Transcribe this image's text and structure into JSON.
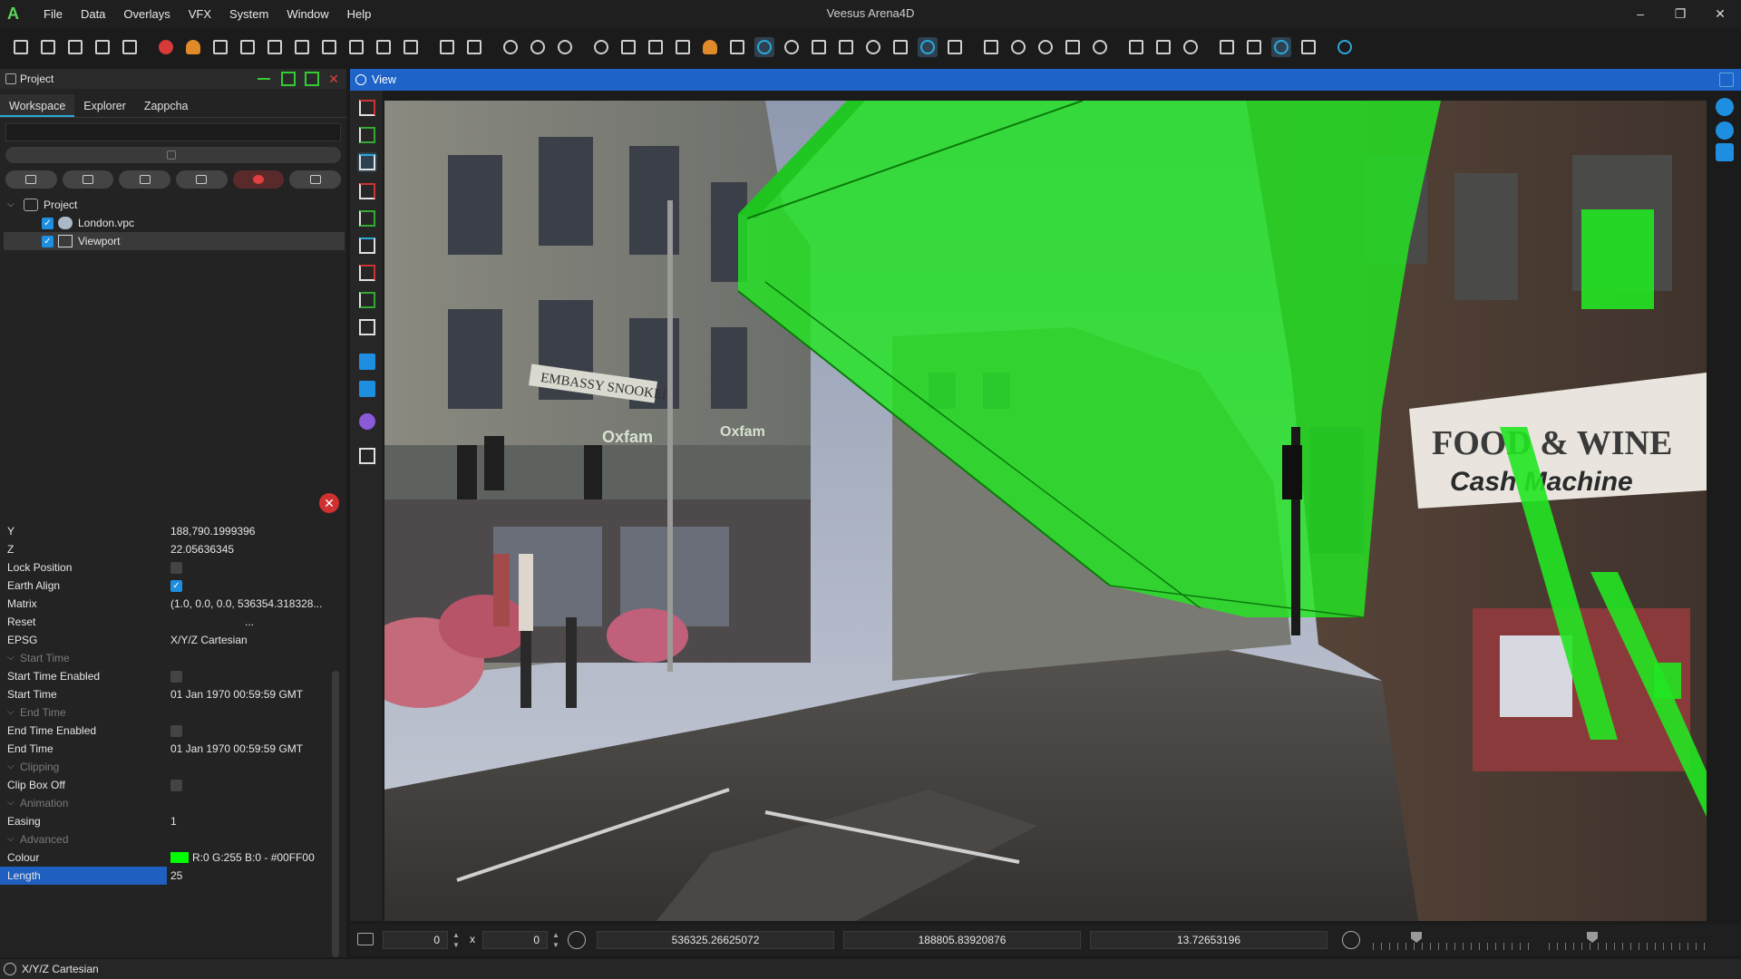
{
  "app": {
    "title": "Veesus Arena4D",
    "logo": "A",
    "menu": [
      "File",
      "Data",
      "Overlays",
      "VFX",
      "System",
      "Window",
      "Help"
    ],
    "window_controls": [
      "–",
      "❐",
      "✕"
    ]
  },
  "project_panel": {
    "title": "Project",
    "tabs": [
      "Workspace",
      "Explorer",
      "Zappcha"
    ],
    "active_tab": "Workspace",
    "tree": {
      "root": "Project",
      "items": [
        {
          "label": "London.vpc",
          "checked": true,
          "icon": "cloud-icon"
        },
        {
          "label": "Viewport",
          "checked": true,
          "icon": "viewport-icon"
        }
      ]
    }
  },
  "properties": {
    "rows": [
      {
        "type": "value",
        "key": "Y",
        "value": "188,790.1999396"
      },
      {
        "type": "value",
        "key": "Z",
        "value": "22.05636345"
      },
      {
        "type": "check",
        "key": "Lock Position",
        "checked": false
      },
      {
        "type": "check",
        "key": "Earth Align",
        "checked": true
      },
      {
        "type": "value",
        "key": "Matrix",
        "value": "(1.0, 0.0, 0.0, 536354.318328..."
      },
      {
        "type": "value",
        "key": "Reset",
        "value": "..."
      },
      {
        "type": "value",
        "key": "EPSG",
        "value": "X/Y/Z Cartesian"
      },
      {
        "type": "section",
        "key": "Start Time"
      },
      {
        "type": "check",
        "key": "Start Time Enabled",
        "checked": false
      },
      {
        "type": "value",
        "key": "Start Time",
        "value": "01 Jan 1970 00:59:59 GMT"
      },
      {
        "type": "section",
        "key": "End Time"
      },
      {
        "type": "check",
        "key": "End Time Enabled",
        "checked": false
      },
      {
        "type": "value",
        "key": "End Time",
        "value": "01 Jan 1970 00:59:59 GMT"
      },
      {
        "type": "section",
        "key": "Clipping"
      },
      {
        "type": "check",
        "key": "Clip Box Off",
        "checked": false
      },
      {
        "type": "section",
        "key": "Animation"
      },
      {
        "type": "value",
        "key": "Easing",
        "value": "1"
      },
      {
        "type": "section",
        "key": "Advanced"
      },
      {
        "type": "colour",
        "key": "Colour",
        "value": "R:0 G:255 B:0 - #00FF00",
        "color": "#00ff00"
      },
      {
        "type": "value",
        "key": "Length",
        "value": "25",
        "selected": true
      }
    ]
  },
  "view": {
    "title": "View",
    "width_value": "0",
    "x_label": "x",
    "height_value": "0",
    "coord_x": "536325.26625072",
    "coord_y": "188805.83920876",
    "coord_z": "13.72653196",
    "scene_sign_1": "FOOD & WINE",
    "scene_sign_2": "Cash Machine",
    "scene_sign_3": "EMBASSY SNOOKER",
    "scene_sign_4": "Oxfam"
  },
  "status": {
    "text": "X/Y/Z Cartesian"
  },
  "colors": {
    "accent": "#1e64c8",
    "highlight": "#00ff00",
    "danger": "#d03030"
  }
}
